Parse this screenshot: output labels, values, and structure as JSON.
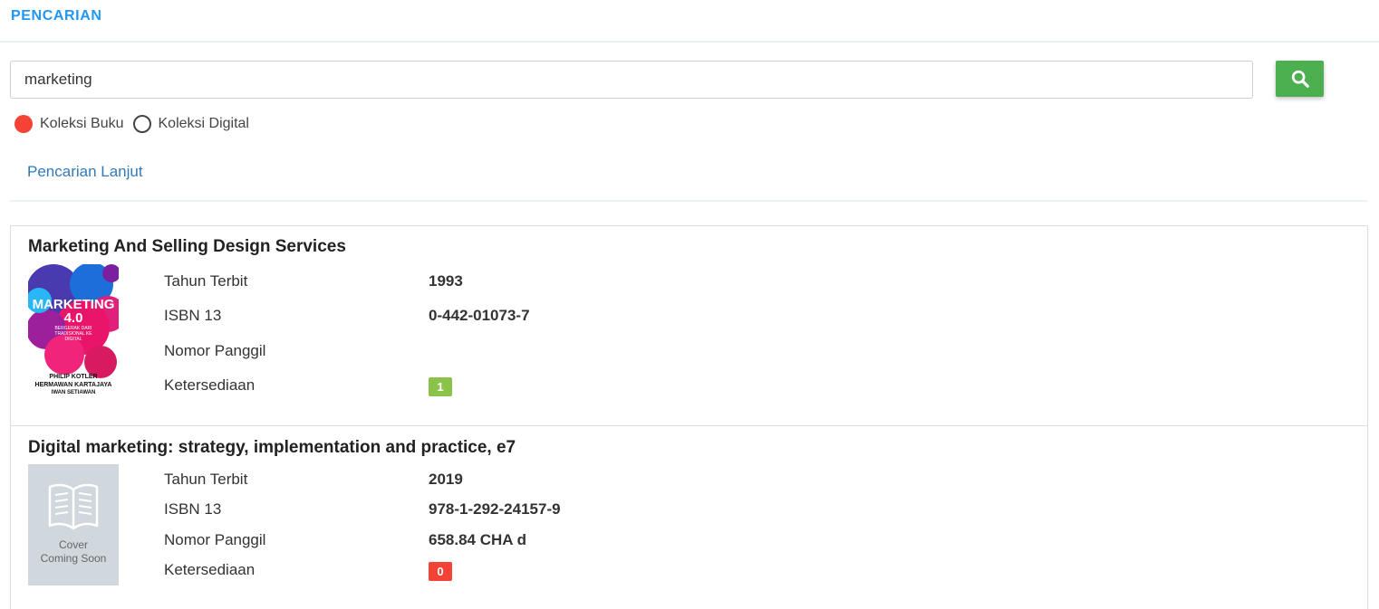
{
  "header": {
    "title": "PENCARIAN"
  },
  "search": {
    "value": "marketing",
    "button_icon": "search-icon"
  },
  "collection_options": [
    {
      "label": "Koleksi Buku",
      "checked": true
    },
    {
      "label": "Koleksi Digital",
      "checked": false
    }
  ],
  "advanced_search_label": "Pencarian Lanjut",
  "colors": {
    "accent": "#2196f3",
    "search_button": "#4caf50",
    "radio_checked": "#f44336",
    "available": "#8bc34a",
    "unavailable": "#f44336",
    "link": "#337ab7"
  },
  "results": [
    {
      "title": "Marketing And Selling Design Services",
      "cover": {
        "title": "MARKETING",
        "subtitle": "4.0",
        "tagline": "BERGERAK DARI TRADISIONAL KE DIGITAL",
        "authors": [
          "PHILIP KOTLER",
          "HERMAWAN KARTAJAYA",
          "IWAN SETIAWAN"
        ]
      },
      "labels": {
        "year": "Tahun Terbit",
        "isbn": "ISBN 13",
        "call": "Nomor Panggil",
        "availability": "Ketersediaan"
      },
      "year": "1993",
      "isbn": "0-442-01073-7",
      "call_number": "",
      "availability": "1"
    },
    {
      "title": "Digital marketing: strategy, implementation and practice, e7",
      "cover": {
        "placeholder_line1": "Cover",
        "placeholder_line2": "Coming Soon",
        "icon": "book-icon"
      },
      "labels": {
        "year": "Tahun Terbit",
        "isbn": "ISBN 13",
        "call": "Nomor Panggil",
        "availability": "Ketersediaan"
      },
      "year": "2019",
      "isbn": "978-1-292-24157-9",
      "call_number": "658.84 CHA d",
      "availability": "0"
    }
  ]
}
